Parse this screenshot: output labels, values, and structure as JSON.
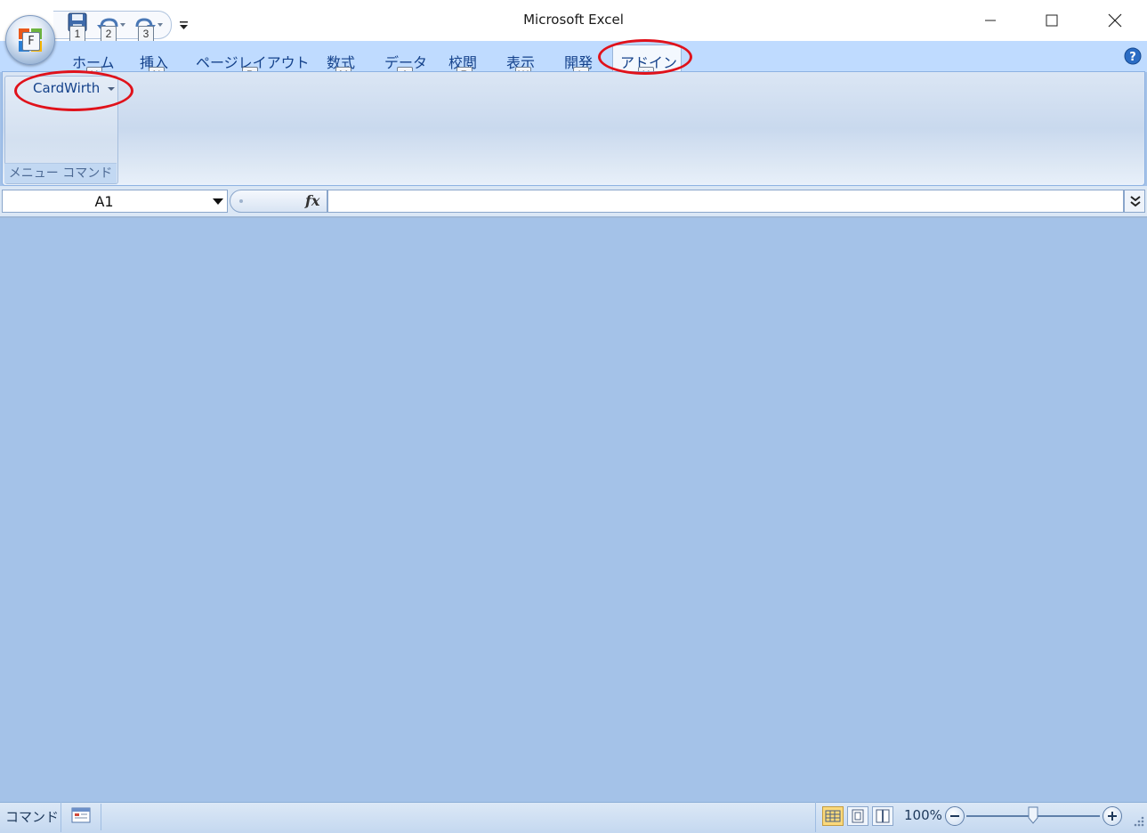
{
  "window": {
    "title": "Microsoft Excel",
    "minimize_icon": "minimize-icon",
    "maximize_icon": "maximize-icon",
    "close_icon": "close-icon"
  },
  "office_button": {
    "keytip": "F"
  },
  "quick_access": {
    "keytips": [
      "1",
      "2",
      "3"
    ],
    "icons": [
      "save-icon",
      "undo-icon",
      "redo-icon",
      "customize-qat-icon"
    ]
  },
  "tabs": [
    {
      "label": "ホーム",
      "keytip": "H"
    },
    {
      "label": "挿入",
      "keytip": "N"
    },
    {
      "label": "ページレイアウト",
      "keytip": "P"
    },
    {
      "label": "数式",
      "keytip": "M"
    },
    {
      "label": "データ",
      "keytip": "A"
    },
    {
      "label": "校閲",
      "keytip": "R"
    },
    {
      "label": "表示",
      "keytip": "W"
    },
    {
      "label": "開発",
      "keytip": "L"
    },
    {
      "label": "アドイン",
      "keytip": "X",
      "active": true
    }
  ],
  "ribbon": {
    "group_label": "メニュー コマンド",
    "menu_button": "CardWirth"
  },
  "formula_bar": {
    "name_box": "A1",
    "fx_label": "fx",
    "formula": ""
  },
  "status_bar": {
    "mode": "コマンド",
    "zoom": "100%"
  },
  "colors": {
    "ribbon_tabs_bg": "#bfdbff",
    "workspace_bg": "#a4c2e8",
    "annotation_red": "#e0121b",
    "tab_text": "#15428b"
  }
}
